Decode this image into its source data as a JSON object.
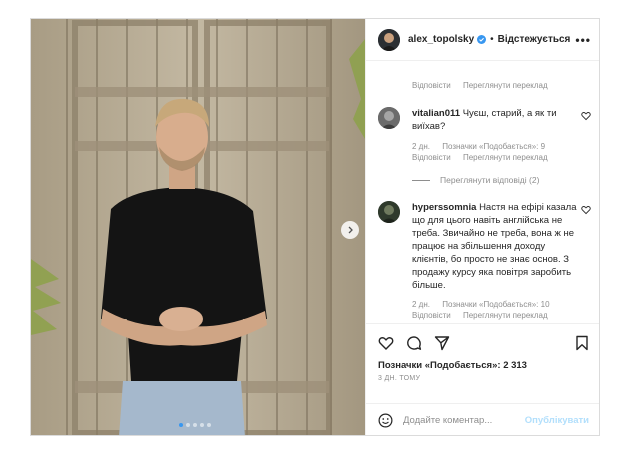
{
  "post": {
    "author": {
      "username": "alex_topolsky",
      "verified": true,
      "follow_label": "Відстежується",
      "separator": "•"
    },
    "more_icon": "more-horizontal-icon"
  },
  "comments": {
    "top_meta": {
      "reply": "Відповісти",
      "translate": "Переглянути переклад"
    },
    "items": [
      {
        "username": "vitalian011",
        "text": "Чуєш, старий, а як ти виїхав?",
        "age": "2 дн.",
        "likes": "Позначки «Подобається»: 9",
        "reply": "Відповісти",
        "translate": "Переглянути переклад"
      },
      {
        "username": "hyperssomnia",
        "text": "Настя на ефірі казала що для цього навіть англійська не треба. Звичайно не треба, вона ж не працює на збільшення доходу клієнтів, бо просто не знає основ. З продажу курсу яка повітря заробить більше.",
        "age": "2 дн.",
        "likes": "Позначки «Подобається»: 10",
        "reply": "Відповісти",
        "translate": "Переглянути переклад"
      }
    ],
    "view_replies": "Переглянути відповіді (2)"
  },
  "actions": {
    "icons": [
      "heart-icon",
      "comment-icon",
      "share-icon",
      "bookmark-icon"
    ],
    "likes": "Позначки «Подобається»: 2 313",
    "date": "3 ДН. ТОМУ"
  },
  "add_comment": {
    "placeholder": "Додайте коментар...",
    "publish_label": "Опублікувати",
    "emoji_icon": "emoji-icon"
  },
  "carousel": {
    "slides": 5,
    "active": 1
  },
  "colors": {
    "link": "#3897f0",
    "publish_disabled": "#b2dffc",
    "muted": "#8e8e8e",
    "text": "#262626"
  }
}
